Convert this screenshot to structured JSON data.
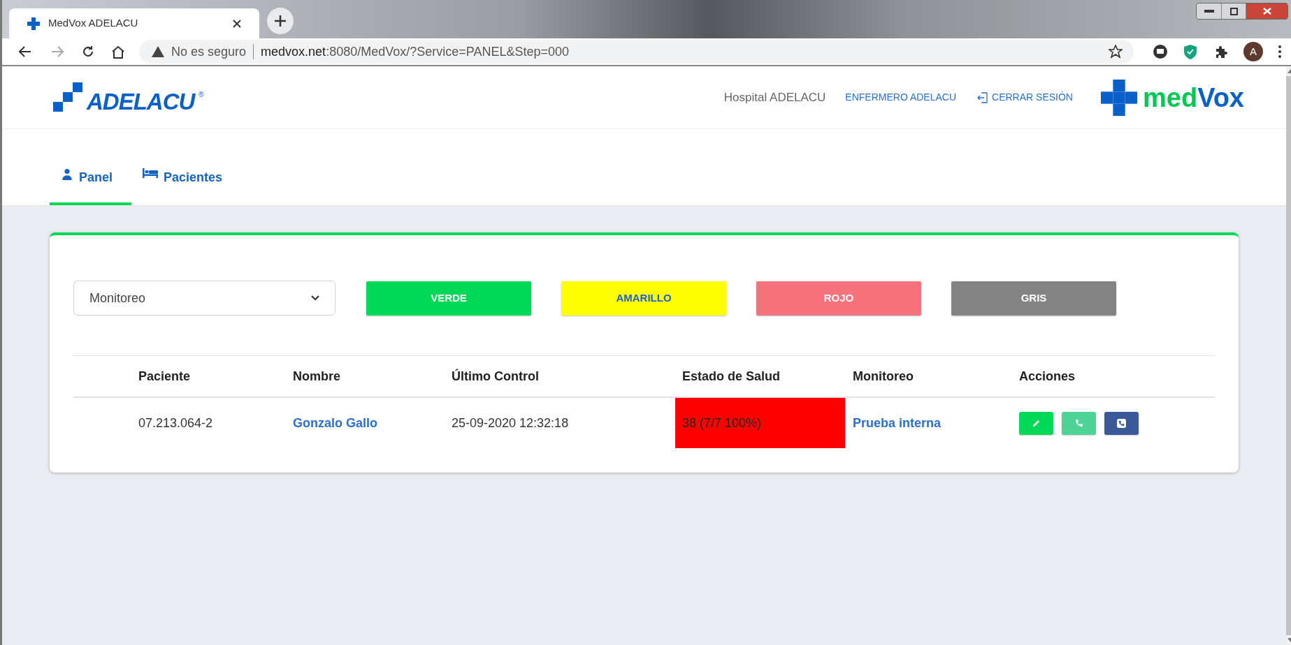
{
  "browser": {
    "tab_title": "MedVox ADELACU",
    "security_label": "No es seguro",
    "url_host": "medvox.net",
    "url_path": ":8080/MedVox/?Service=PANEL&Step=000",
    "profile_initial": "A"
  },
  "header": {
    "logo_text": "ADELACU",
    "logo_mark": "®",
    "hospital": "Hospital ADELACU",
    "user": "ENFERMERO ADELACU",
    "logout": "CERRAR SESIÓN",
    "brand_left": "med",
    "brand_right": "Vox"
  },
  "nav_tabs": [
    {
      "label": "Panel",
      "kind": "doctor",
      "selected": true
    },
    {
      "label": "Pacientes",
      "kind": "bed",
      "selected": false
    }
  ],
  "filter": {
    "value": "Monitoreo"
  },
  "status_buttons": [
    {
      "label": "VERDE",
      "color": "#00d957"
    },
    {
      "label": "AMARILLO",
      "color": "#ffff00"
    },
    {
      "label": "ROJO",
      "color": "#f6727c"
    },
    {
      "label": "GRIS",
      "color": "#838383"
    }
  ],
  "table": {
    "columns": [
      "Paciente",
      "Nombre",
      "Último Control",
      "Estado de Salud",
      "Monitoreo",
      "Acciones"
    ],
    "rows": [
      {
        "paciente": "07.213.064-2",
        "nombre": "Gonzalo Gallo",
        "ultimo_control": "25-09-2020 12:32:18",
        "estado": "38 (7/7 100%)",
        "color": "#ff0000",
        "monitoreo": "Prueba interna",
        "actions": [
          {
            "kind": "edit",
            "color": "#00d957"
          },
          {
            "kind": "call",
            "color": "#4cd395"
          },
          {
            "kind": "video",
            "color": "#3b5998"
          }
        ]
      }
    ]
  }
}
